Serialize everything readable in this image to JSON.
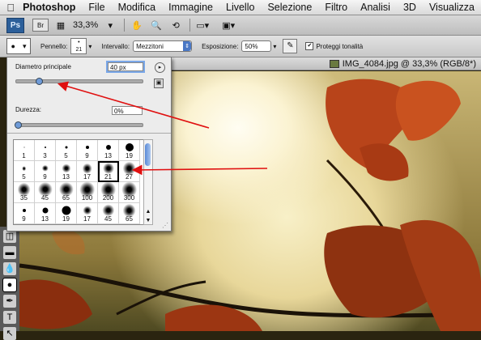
{
  "menubar": {
    "apple": "",
    "app": "Photoshop",
    "items": [
      "File",
      "Modifica",
      "Immagine",
      "Livello",
      "Selezione",
      "Filtro",
      "Analisi",
      "3D",
      "Visualizza"
    ]
  },
  "appbar": {
    "ps": "Ps",
    "br": "Br",
    "zoom": "33,3%"
  },
  "options": {
    "brush_label": "Pennello:",
    "brush_size": "21",
    "range_label": "Intervallo:",
    "range_value": "Mezzitoni",
    "exposure_label": "Esposizione:",
    "exposure_value": "50%",
    "protect_label": "Proteggi tonalità",
    "protect_checked": "✔"
  },
  "document": {
    "title": "IMG_4084.jpg @ 33,3% (RGB/8*)"
  },
  "brush_panel": {
    "diameter_label": "Diametro principale",
    "diameter_value": "40 px",
    "diameter_fraction": 0.18,
    "hardness_label": "Durezza:",
    "hardness_value": "0%",
    "hardness_fraction": 0.0,
    "presets": [
      {
        "size": "1",
        "kind": "hard",
        "d": 1
      },
      {
        "size": "3",
        "kind": "hard",
        "d": 2
      },
      {
        "size": "5",
        "kind": "hard",
        "d": 3
      },
      {
        "size": "9",
        "kind": "hard",
        "d": 4
      },
      {
        "size": "13",
        "kind": "hard",
        "d": 6
      },
      {
        "size": "19",
        "kind": "hard",
        "d": 10
      },
      {
        "size": "5",
        "kind": "soft",
        "d": 4
      },
      {
        "size": "9",
        "kind": "soft",
        "d": 6
      },
      {
        "size": "13",
        "kind": "soft",
        "d": 8
      },
      {
        "size": "17",
        "kind": "soft",
        "d": 9
      },
      {
        "size": "21",
        "kind": "soft",
        "d": 10,
        "selected": true
      },
      {
        "size": "27",
        "kind": "soft",
        "d": 12
      },
      {
        "size": "35",
        "kind": "soft",
        "d": 12
      },
      {
        "size": "45",
        "kind": "soft",
        "d": 13
      },
      {
        "size": "65",
        "kind": "soft",
        "d": 13
      },
      {
        "size": "100",
        "kind": "soft",
        "d": 14
      },
      {
        "size": "200",
        "kind": "soft",
        "d": 14
      },
      {
        "size": "300",
        "kind": "soft",
        "d": 14
      },
      {
        "size": "9",
        "kind": "hard",
        "d": 4
      },
      {
        "size": "13",
        "kind": "hard",
        "d": 7
      },
      {
        "size": "19",
        "kind": "hard",
        "d": 11
      },
      {
        "size": "17",
        "kind": "soft",
        "d": 8
      },
      {
        "size": "45",
        "kind": "soft",
        "d": 11
      },
      {
        "size": "65",
        "kind": "soft",
        "d": 12
      }
    ]
  },
  "colors": {
    "annotation_arrow": "#e01010",
    "leaf": "#b8441a"
  }
}
